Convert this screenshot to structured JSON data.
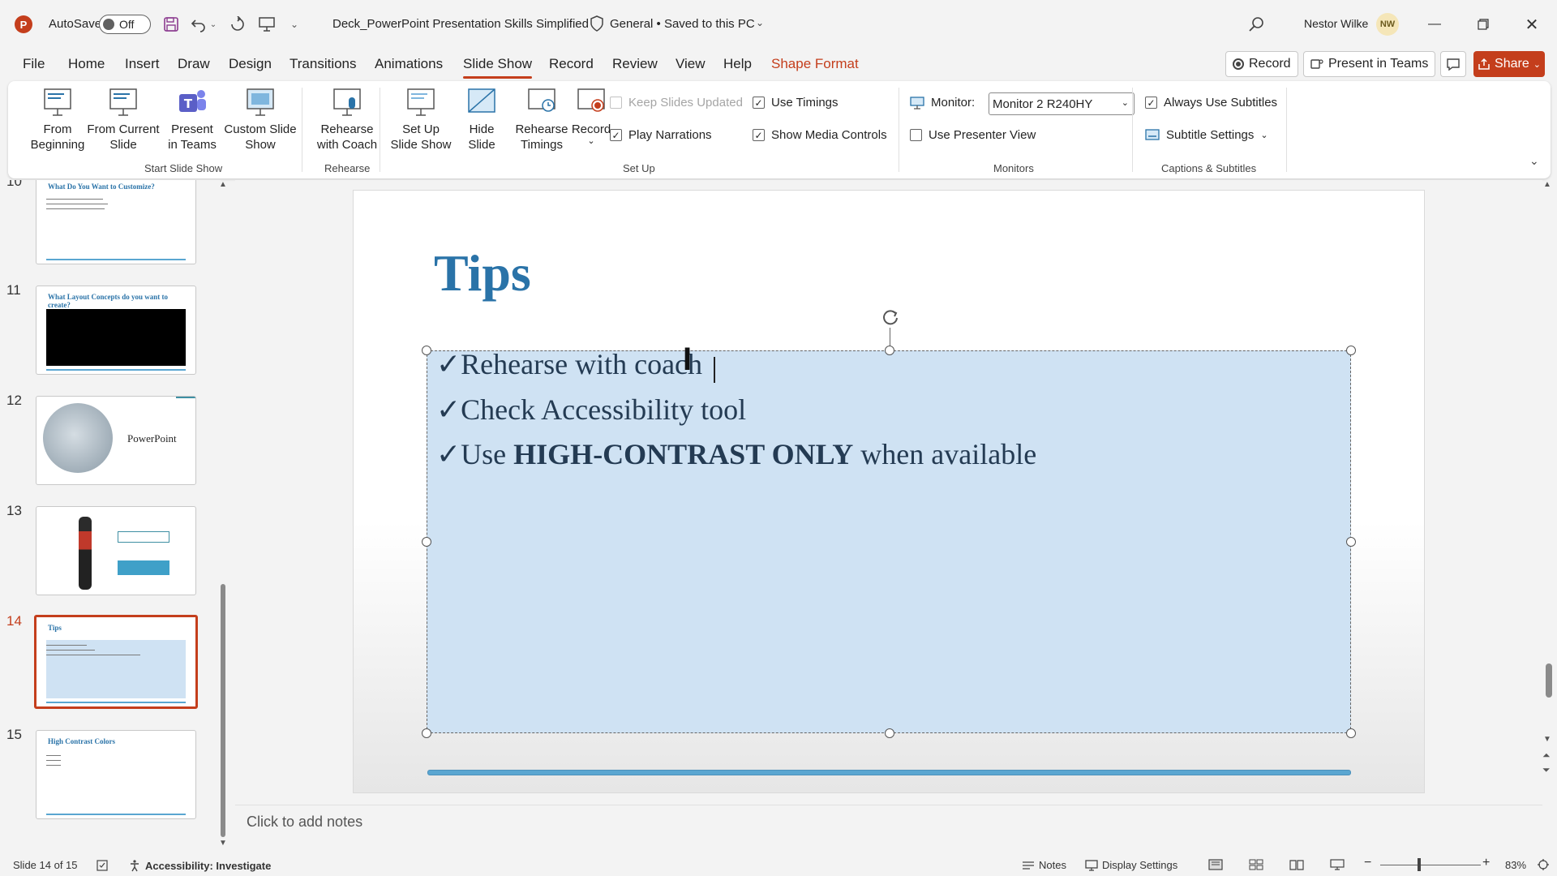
{
  "titlebar": {
    "app_letter": "P",
    "autosave_label": "AutoSave",
    "autosave_state": "Off",
    "doc_title": "Deck_PowerPoint Presentation Skills Simplified",
    "sensitivity": "General • Saved to this PC",
    "user_name": "Nestor Wilke",
    "user_initials": "NW"
  },
  "menu": {
    "tabs": [
      "File",
      "Home",
      "Insert",
      "Draw",
      "Design",
      "Transitions",
      "Animations",
      "Slide Show",
      "Record",
      "Review",
      "View",
      "Help",
      "Shape Format"
    ],
    "active_tab": "Slide Show",
    "record_label": "Record",
    "present_teams_label": "Present in Teams",
    "share_label": "Share"
  },
  "ribbon": {
    "from_beginning": "From Beginning",
    "from_current": "From Current Slide",
    "present_in_teams": "Present in Teams",
    "custom_slide_show": "Custom Slide Show",
    "group_start": "Start Slide Show",
    "rehearse_with_coach": "Rehearse with Coach",
    "group_rehearse": "Rehearse",
    "set_up_slide_show": "Set Up Slide Show",
    "hide_slide": "Hide Slide",
    "rehearse_timings": "Rehearse Timings",
    "record": "Record",
    "keep_slides_updated": "Keep Slides Updated",
    "play_narrations": "Play Narrations",
    "use_timings": "Use Timings",
    "show_media_controls": "Show Media Controls",
    "group_setup": "Set Up",
    "monitor_label": "Monitor:",
    "monitor_value": "Monitor 2 R240HY",
    "use_presenter_view": "Use Presenter View",
    "group_monitors": "Monitors",
    "always_use_subtitles": "Always Use Subtitles",
    "subtitle_settings": "Subtitle Settings",
    "group_captions": "Captions & Subtitles",
    "accent": "#c43e1c"
  },
  "thumbnails": [
    {
      "num": "10",
      "title": "What Do You Want to Customize?"
    },
    {
      "num": "11",
      "title": "What Layout Concepts do you want to create?"
    },
    {
      "num": "12",
      "title": "PowerPoint"
    },
    {
      "num": "13",
      "title": ""
    },
    {
      "num": "14",
      "title": "Tips"
    },
    {
      "num": "15",
      "title": "High Contrast Colors"
    }
  ],
  "slide": {
    "title": "Tips",
    "bullets": [
      {
        "check": "✓",
        "text": "Rehearse with coach"
      },
      {
        "check": "✓",
        "text": "Check Accessibility tool"
      },
      {
        "check": "✓",
        "pre": "Use ",
        "bold": "HIGH-CONTRAST ONLY",
        "post": " when available"
      }
    ]
  },
  "notes": {
    "placeholder": "Click to add notes"
  },
  "status": {
    "slide_counter": "Slide 14 of 15",
    "accessibility": "Accessibility: Investigate",
    "notes": "Notes",
    "display_settings": "Display Settings",
    "zoom": "83%"
  }
}
